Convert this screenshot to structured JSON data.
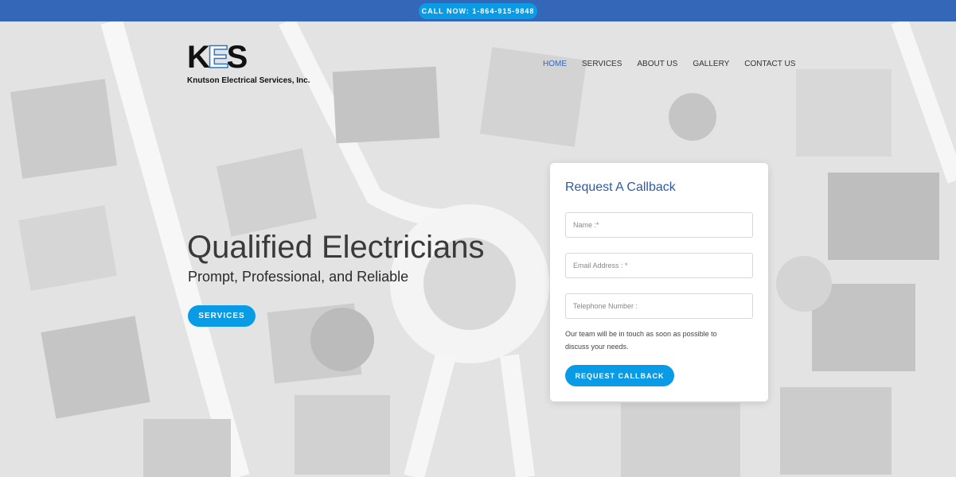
{
  "topbar": {
    "call_label": "CALL NOW: 1-864-915-9848"
  },
  "brand": {
    "logo_mark": "KES",
    "name": "Knutson Electrical Services, Inc."
  },
  "nav": {
    "items": [
      "HOME",
      "SERVICES",
      "ABOUT US",
      "GALLERY",
      "CONTACT US"
    ],
    "active": "HOME"
  },
  "hero": {
    "headline": "Qualified Electricians",
    "subline": "Prompt, Professional, and Reliable",
    "button": "SERVICES"
  },
  "callback_form": {
    "title": "Request A Callback",
    "name_placeholder": "Name :*",
    "email_placeholder": "Email Address : *",
    "phone_placeholder": "Telephone Number :",
    "note": "Our team will be in touch as soon as possible to discuss your needs.",
    "submit": "REQUEST CALLBACK"
  },
  "colors": {
    "topbar": "#3567b9",
    "accent": "#0a9be6",
    "title_blue": "#2d5aa8"
  }
}
